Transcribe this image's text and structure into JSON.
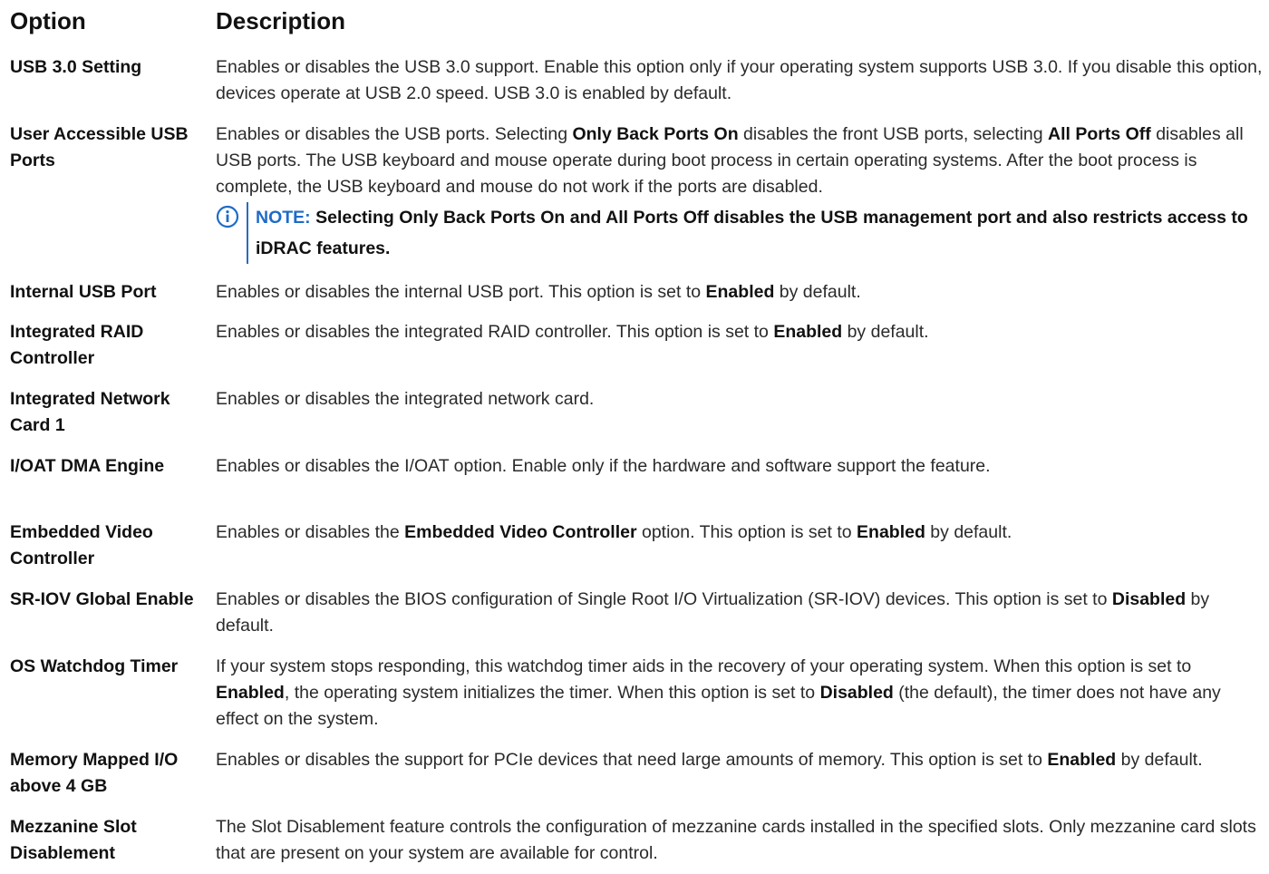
{
  "header": {
    "option": "Option",
    "description": "Description"
  },
  "rows": [
    {
      "option": "USB 3.0 Setting",
      "desc": "Enables or disables the USB 3.0 support. Enable this option only if your operating system supports USB 3.0. If you disable this option, devices operate at USB 2.0 speed. USB 3.0 is enabled by default."
    },
    {
      "option": "User Accessible USB Ports",
      "desc_parts": [
        "Enables or disables the USB ports. Selecting ",
        "Only Back Ports On",
        " disables the front USB ports, selecting ",
        "All Ports Off",
        " disables all USB ports. The USB keyboard and mouse operate during boot process in certain operating systems. After the boot process is complete, the USB keyboard and mouse do not work if the ports are disabled."
      ],
      "note_label": "NOTE:",
      "note_text": " Selecting Only Back Ports On and All Ports Off disables the USB management port and also restricts access to iDRAC features."
    },
    {
      "option": "Internal USB Port",
      "desc_parts": [
        "Enables or disables the internal USB port. This option is set to ",
        "Enabled",
        " by default."
      ]
    },
    {
      "option": "Integrated RAID Controller",
      "desc_parts": [
        "Enables or disables the integrated RAID controller. This option is set to ",
        "Enabled",
        " by default."
      ]
    },
    {
      "option": "Integrated Network Card 1",
      "desc": "Enables or disables the integrated network card."
    },
    {
      "option": "I/OAT DMA Engine",
      "desc": "Enables or disables the I/OAT option. Enable only if the hardware and software support the feature."
    },
    {
      "option": "Embedded Video Controller",
      "desc_parts": [
        "Enables or disables the ",
        "Embedded Video Controller",
        " option. This option is set to ",
        "Enabled",
        " by default."
      ]
    },
    {
      "option": "SR-IOV Global Enable",
      "desc_parts": [
        "Enables or disables the BIOS configuration of Single Root I/O Virtualization (SR-IOV) devices. This option is set to ",
        "Disabled",
        " by default."
      ]
    },
    {
      "option": "OS Watchdog Timer",
      "desc_parts": [
        "If your system stops responding, this watchdog timer aids in the recovery of your operating system. When this option is set to ",
        "Enabled",
        ", the operating system initializes the timer. When this option is set to ",
        "Disabled",
        " (the default), the timer does not have any effect on the system."
      ]
    },
    {
      "option": "Memory Mapped I/O above 4 GB",
      "desc_parts": [
        "Enables or disables the support for PCIe devices that need large amounts of memory. This option is set to ",
        "Enabled",
        " by default."
      ]
    },
    {
      "option": "Mezzanine Slot Disablement",
      "desc": "The Slot Disablement feature controls the configuration of mezzanine cards installed in the specified slots. Only mezzanine card slots that are present on your system are available for control."
    }
  ],
  "colors": {
    "note_accent": "#1e6bc8",
    "text": "#2a2a2a"
  },
  "icons": {
    "note": "info-circle-icon"
  }
}
